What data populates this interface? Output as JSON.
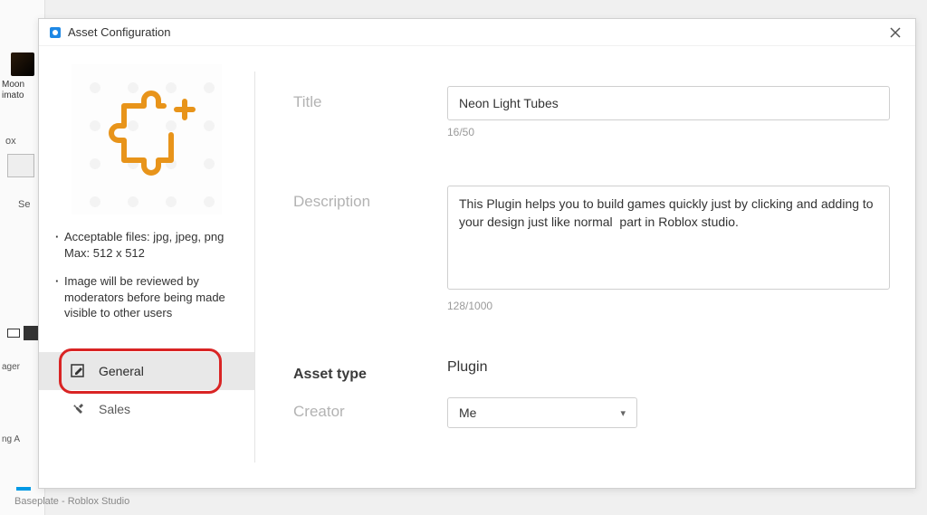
{
  "background": {
    "moon_label_line1": "Moon",
    "moon_label_line2": "imato",
    "box_label": "ox",
    "se_label": "Se",
    "ager_label": "ager",
    "nga_label": "ng A",
    "baseplate_label": "Baseplate - Roblox Studio"
  },
  "dialog": {
    "title": "Asset Configuration"
  },
  "sidebar": {
    "hints": {
      "acceptable_line1": "Acceptable files: jpg, jpeg, png",
      "acceptable_line2": "Max: 512 x 512",
      "review": "Image will be reviewed by moderators before being made visible to other users"
    },
    "tabs": [
      {
        "label": "General"
      },
      {
        "label": "Sales"
      }
    ]
  },
  "form": {
    "title_label": "Title",
    "title_value": "Neon Light Tubes",
    "title_counter": "16/50",
    "description_label": "Description",
    "description_value": "This Plugin helps you to build games quickly just by clicking and adding to your design just like normal  part in Roblox studio.",
    "description_counter": "128/1000",
    "asset_type_label": "Asset type",
    "asset_type_value": "Plugin",
    "creator_label": "Creator",
    "creator_value": "Me"
  }
}
